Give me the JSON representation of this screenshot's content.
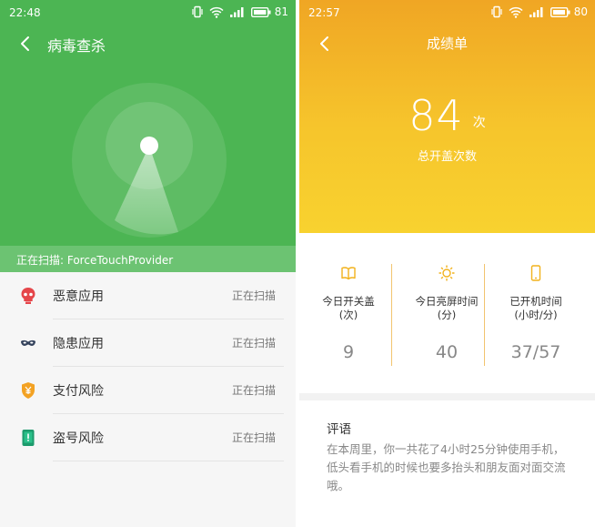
{
  "left": {
    "status": {
      "time": "22:48",
      "battery": "81"
    },
    "title": "病毒查杀",
    "scanning_text": "正在扫描: ForceTouchProvider",
    "items": [
      {
        "label": "恶意应用",
        "status": "正在扫描",
        "icon": "skull-icon"
      },
      {
        "label": "隐患应用",
        "status": "正在扫描",
        "icon": "mask-icon"
      },
      {
        "label": "支付风险",
        "status": "正在扫描",
        "icon": "yen-shield-icon"
      },
      {
        "label": "盗号风险",
        "status": "正在扫描",
        "icon": "phone-alert-icon"
      }
    ],
    "colors": {
      "hero": "#4cb553",
      "scanbar": "#6cc372"
    }
  },
  "right": {
    "status": {
      "time": "22:57",
      "battery": "80"
    },
    "title": "成绩单",
    "count": "84",
    "count_unit": "次",
    "count_label": "总开盖次数",
    "stats": [
      {
        "label_line1": "今日开关盖",
        "label_line2": "(次)",
        "value": "9",
        "icon": "book-icon"
      },
      {
        "label_line1": "今日亮屏时间",
        "label_line2": "(分)",
        "value": "40",
        "icon": "sun-icon"
      },
      {
        "label_line1": "已开机时间",
        "label_line2": "(小时/分)",
        "value": "37/57",
        "icon": "phone-icon"
      }
    ],
    "comment_title": "评语",
    "comment_text": "在本周里，你一共花了4小时25分钟使用手机，低头看手机的时候也要多抬头和朋友面对面交流哦。",
    "colors": {
      "hero_top": "#f0a624",
      "hero_bottom": "#f8d22f",
      "accent": "#f2b21c"
    }
  }
}
